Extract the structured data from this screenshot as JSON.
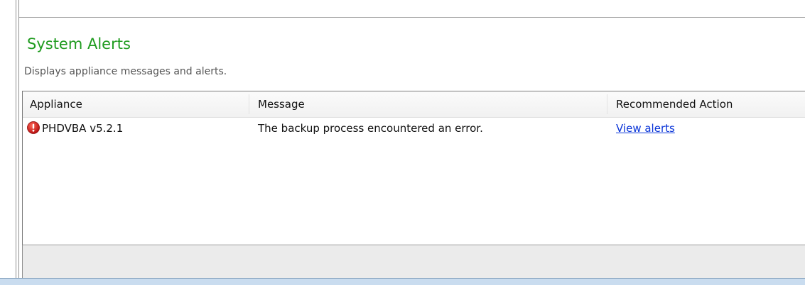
{
  "panel": {
    "title": "System Alerts",
    "subtitle": "Displays appliance messages and alerts."
  },
  "grid": {
    "columns": {
      "appliance": "Appliance",
      "message": "Message",
      "recommended_action": "Recommended Action"
    },
    "rows": [
      {
        "status_icon": "error-icon",
        "appliance": "PHDVBA v5.2.1",
        "message": "The backup process encountered an error.",
        "recommended_action": "View alerts"
      }
    ]
  },
  "colors": {
    "title": "#1f9b1f",
    "link": "#0a35d8",
    "error_icon": "#d01818"
  }
}
